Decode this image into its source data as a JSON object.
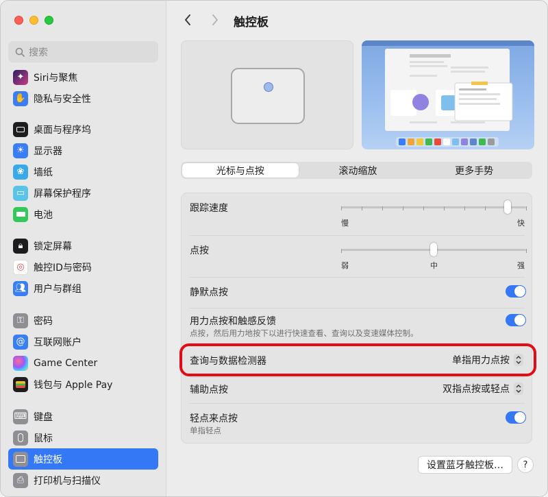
{
  "window": {
    "title": "触控板"
  },
  "search": {
    "placeholder": "搜索"
  },
  "sidebar": {
    "items": [
      {
        "label": "Siri与聚焦",
        "icon": "siri-icon"
      },
      {
        "label": "隐私与安全性",
        "icon": "hand-icon"
      },
      {
        "label": "桌面与程序坞",
        "icon": "dock-icon"
      },
      {
        "label": "显示器",
        "icon": "sun-icon"
      },
      {
        "label": "墙纸",
        "icon": "flower-icon"
      },
      {
        "label": "屏幕保护程序",
        "icon": "screensaver-icon"
      },
      {
        "label": "电池",
        "icon": "battery-icon"
      },
      {
        "label": "锁定屏幕",
        "icon": "lock-icon"
      },
      {
        "label": "触控ID与密码",
        "icon": "fingerprint-icon"
      },
      {
        "label": "用户与群组",
        "icon": "users-icon"
      },
      {
        "label": "密码",
        "icon": "key-icon"
      },
      {
        "label": "互联网账户",
        "icon": "at-icon"
      },
      {
        "label": "Game Center",
        "icon": "game-center-icon"
      },
      {
        "label": "钱包与 Apple Pay",
        "icon": "wallet-icon"
      },
      {
        "label": "键盘",
        "icon": "keyboard-icon"
      },
      {
        "label": "鼠标",
        "icon": "mouse-icon"
      },
      {
        "label": "触控板",
        "icon": "trackpad-icon"
      },
      {
        "label": "打印机与扫描仪",
        "icon": "printer-icon"
      }
    ],
    "selected": "触控板"
  },
  "tabs": [
    {
      "label": "光标与点按",
      "active": true
    },
    {
      "label": "滚动缩放",
      "active": false
    },
    {
      "label": "更多手势",
      "active": false
    }
  ],
  "settings": {
    "tracking": {
      "label": "跟踪速度",
      "min_label": "慢",
      "max_label": "快",
      "value_fraction": 0.9
    },
    "click": {
      "label": "点按",
      "min_label": "弱",
      "mid_label": "中",
      "max_label": "强",
      "value_fraction": 0.5
    },
    "silent_click": {
      "label": "静默点按",
      "on": true
    },
    "force_click": {
      "label": "用力点按和触感反馈",
      "description": "点按，然后用力地按下以进行快速查看、查询以及变速媒体控制。",
      "on": true
    },
    "lookup": {
      "label": "查询与数据检测器",
      "value": "单指用力点按"
    },
    "secondary_click": {
      "label": "辅助点按",
      "value": "双指点按或轻点"
    },
    "tap_to_click": {
      "label": "轻点来点按",
      "description": "单指轻点",
      "on": true
    }
  },
  "footer": {
    "bluetooth_button": "设置蓝牙触控板…",
    "help_button": "?"
  },
  "colors": {
    "accent": "#3478f6",
    "highlight": "#e40b17"
  }
}
